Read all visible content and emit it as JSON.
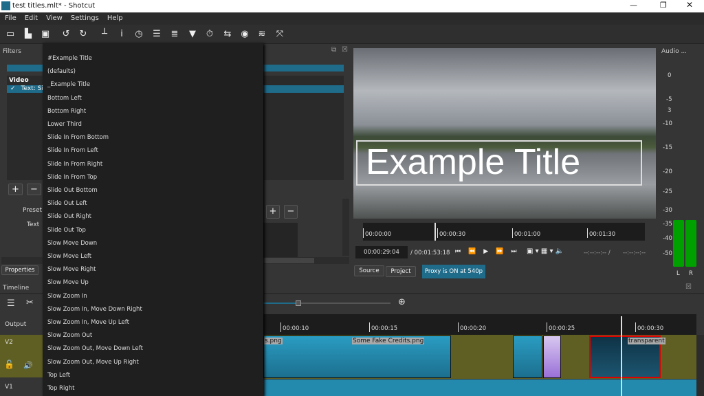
{
  "window": {
    "title": "test titles.mlt* - Shotcut",
    "controls": [
      "minimize",
      "restore",
      "close"
    ]
  },
  "menu": [
    "File",
    "Edit",
    "View",
    "Settings",
    "Help"
  ],
  "toolbar_icons": [
    "open-icon",
    "open-other-icon",
    "save-icon",
    "undo-icon",
    "redo-icon",
    "peak-meter-icon",
    "properties-icon",
    "recent-icon",
    "playlist-icon",
    "history-icon",
    "filters-icon",
    "keyframes-icon",
    "export-icon",
    "jobs-icon",
    "layers-icon",
    "fullscreen-icon"
  ],
  "filters": {
    "title": "Filters",
    "section": "Video",
    "item": "Text: Si",
    "preset_label": "Preset",
    "text_label": "Text",
    "tabs": [
      "Properties"
    ]
  },
  "dropdown": {
    "items": [
      "#Example Title",
      "(defaults)",
      "_Example Title",
      "Bottom Left",
      "Bottom Right",
      "Lower Third",
      "Slide In From Bottom",
      "Slide In From Left",
      "Slide In From Right",
      "Slide In From Top",
      "Slide Out Bottom",
      "Slide Out Left",
      "Slide Out Right",
      "Slide Out Top",
      "Slow Move Down",
      "Slow Move Left",
      "Slow Move Right",
      "Slow Move Up",
      "Slow Zoom In",
      "Slow Zoom In, Move Down Right",
      "Slow Zoom In, Move Up Left",
      "Slow Zoom Out",
      "Slow Zoom Out, Move Down Left",
      "Slow Zoom Out, Move Up Right",
      "Top Left",
      "Top Right"
    ]
  },
  "player": {
    "overlay_text": "Example Title",
    "ruler": [
      "00:00:00",
      "00:00:30",
      "00:01:00",
      "00:01:30"
    ],
    "position": "00:00:29:04",
    "duration": "/ 00:01:53:18",
    "in_out": "--:--:--:-- /",
    "out": "--:--:--:--",
    "tabs": [
      "Source",
      "Project"
    ],
    "proxy": "Proxy is ON at 540p"
  },
  "audio": {
    "title": "Audio ...",
    "scale": [
      "3",
      "0",
      "-5",
      "-10",
      "-15",
      "-20",
      "-25",
      "-30",
      "-35",
      "-40",
      "-50"
    ],
    "channels": [
      "L",
      "R"
    ]
  },
  "timeline": {
    "title": "Timeline",
    "output": "Output",
    "tracks": [
      "V2",
      "V1"
    ],
    "ruler": [
      "00:00:10",
      "00:00:15",
      "00:00:20",
      "00:00:25",
      "00:00:30"
    ],
    "clips": [
      "s.png",
      "Some Fake Credits.png",
      "transparent"
    ]
  },
  "colors": {
    "accent": "#1e6b8a",
    "clip": "#2389ad",
    "track_bg": "#5f5f23",
    "meter": "#00a000",
    "selected": "#e00000"
  }
}
